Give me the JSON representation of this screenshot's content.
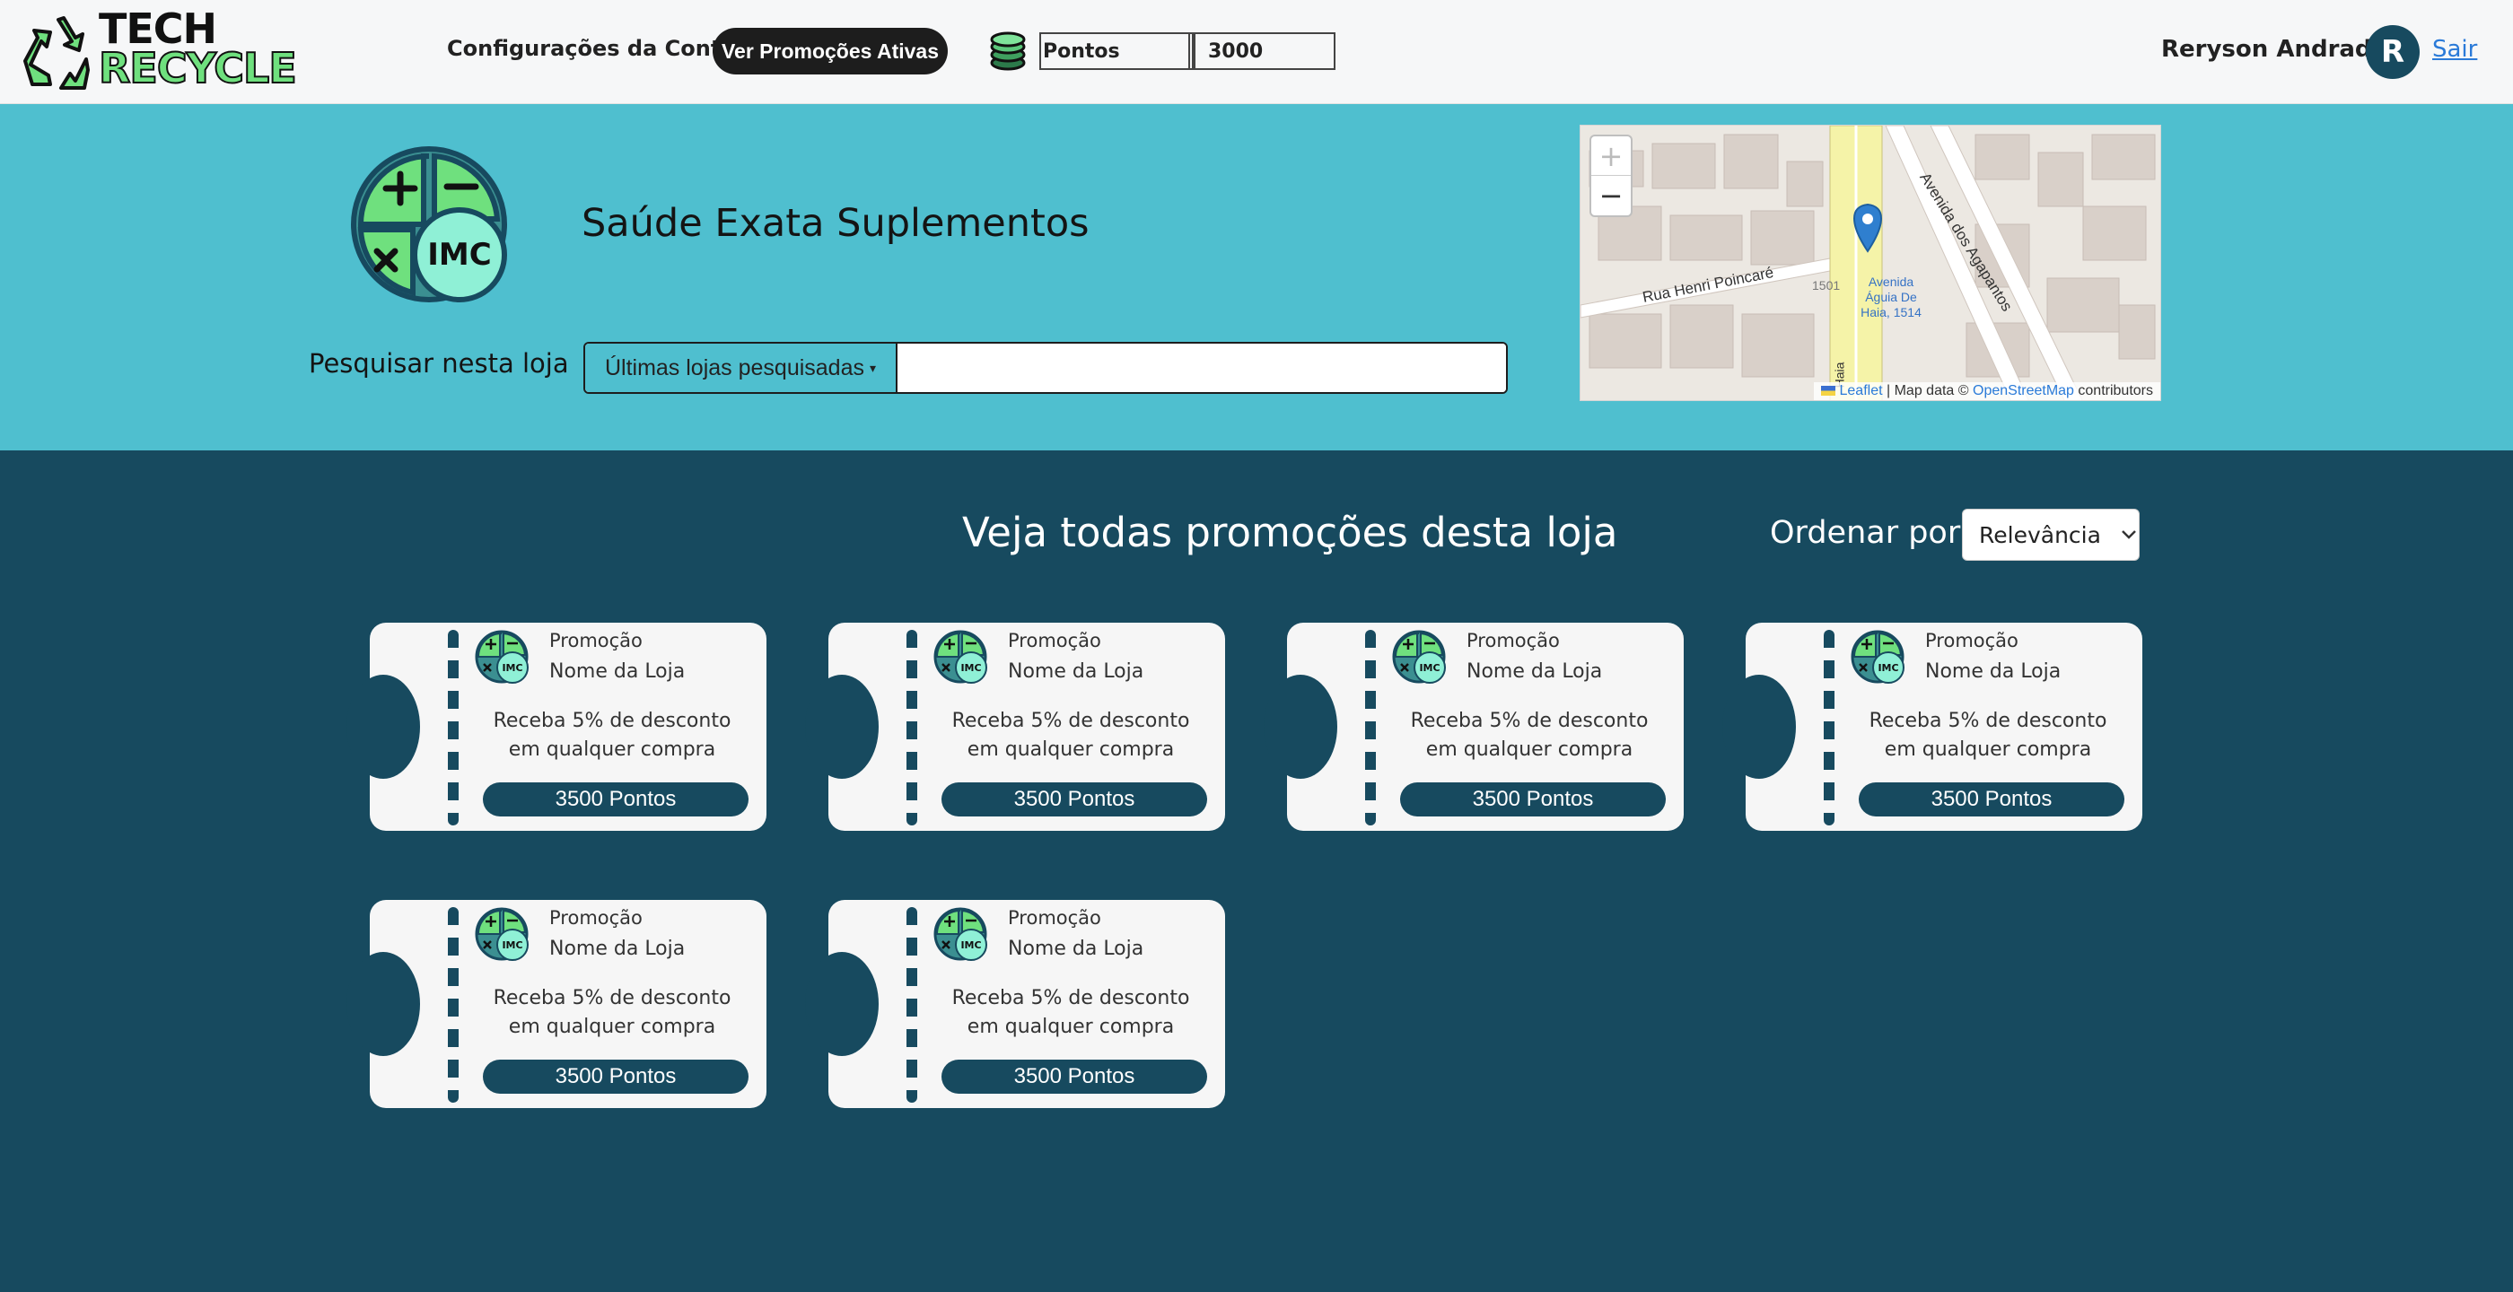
{
  "header": {
    "logo_line1": "TECH",
    "logo_line2": "RECYCLE",
    "account_link": "Configurações da Conta",
    "promos_button": "Ver Promoções Ativas",
    "points_label": "Pontos",
    "points_value": "3000",
    "user_name": "Reryson Andrade",
    "avatar_initial": "R",
    "logout": "Sair"
  },
  "store": {
    "name": "Saúde Exata Suplementos",
    "logo_text": "IMC",
    "search_label": "Pesquisar nesta loja",
    "dropdown_label": "Últimas lojas pesquisadas",
    "search_value": ""
  },
  "map": {
    "street_1": "Rua Henri Poincaré",
    "street_2": "Avenida dos Agapantos",
    "number_label": "1501",
    "partial_label": "Haia",
    "poi_label": "Avenida Águia De Haia, 1514",
    "attr_leaflet": "Leaflet",
    "attr_text": "| Map data ©",
    "attr_osm": "OpenStreetMap",
    "attr_contrib": "contributors"
  },
  "promotions": {
    "title": "Veja todas promoções desta loja",
    "sort_label": "Ordenar por:",
    "sort_value": "Relevância",
    "items": [
      {
        "type": "Promoção",
        "store": "Nome da Loja",
        "desc": "Receba 5% de desconto em qualquer compra",
        "points": "3500 Pontos"
      },
      {
        "type": "Promoção",
        "store": "Nome da Loja",
        "desc": "Receba 5% de desconto em qualquer compra",
        "points": "3500 Pontos"
      },
      {
        "type": "Promoção",
        "store": "Nome da Loja",
        "desc": "Receba 5% de desconto em qualquer compra",
        "points": "3500 Pontos"
      },
      {
        "type": "Promoção",
        "store": "Nome da Loja",
        "desc": "Receba 5% de desconto em qualquer compra",
        "points": "3500 Pontos"
      },
      {
        "type": "Promoção",
        "store": "Nome da Loja",
        "desc": "Receba 5% de desconto em qualquer compra",
        "points": "3500 Pontos"
      },
      {
        "type": "Promoção",
        "store": "Nome da Loja",
        "desc": "Receba 5% de desconto em qualquer compra",
        "points": "3500 Pontos"
      }
    ]
  },
  "colors": {
    "header_bg": "#f6f7f8",
    "banner_bg": "#4fbfcf",
    "page_bg": "#174a5f",
    "accent_green": "#6fe07e",
    "ticket_bg": "#f6f6f6"
  },
  "icons": [
    "recycle-icon",
    "coin-stack-icon",
    "calculator-icon",
    "map-pin-icon",
    "chevron-down-icon",
    "flag-icon"
  ]
}
